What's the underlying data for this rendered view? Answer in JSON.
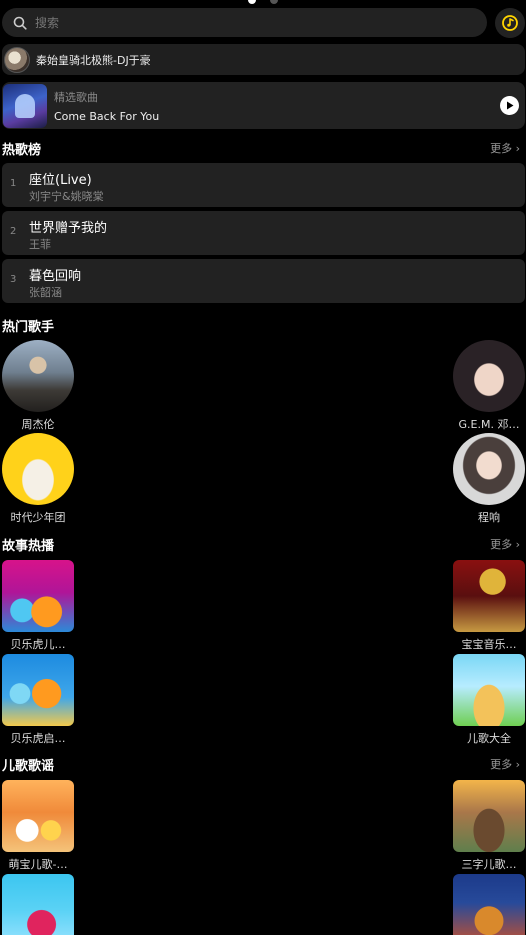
{
  "search": {
    "placeholder": "搜索"
  },
  "now_playing": {
    "title": "秦始皇骑北极熊-DJ于豪"
  },
  "featured": {
    "label": "精选歌曲",
    "song": "Come Back For You"
  },
  "hot_songs": {
    "title": "热歌榜",
    "more": "更多",
    "items": [
      {
        "rank": "1",
        "song": "座位(Live)",
        "artist": "刘宇宁&姚晓棠"
      },
      {
        "rank": "2",
        "song": "世界赠予我的",
        "artist": "王菲"
      },
      {
        "rank": "3",
        "song": "暮色回响",
        "artist": "张韶涵"
      }
    ]
  },
  "hot_singers": {
    "title": "热门歌手",
    "items": [
      {
        "name": "周杰伦"
      },
      {
        "name": "G.E.M. 邓…"
      },
      {
        "name": "时代少年团"
      },
      {
        "name": "程响"
      }
    ]
  },
  "stories": {
    "title": "故事热播",
    "more": "更多",
    "items": [
      {
        "name": "贝乐虎儿…"
      },
      {
        "name": "宝宝音乐…"
      },
      {
        "name": "贝乐虎启…"
      },
      {
        "name": "儿歌大全"
      }
    ]
  },
  "kids_songs": {
    "title": "儿歌歌谣",
    "more": "更多",
    "items": [
      {
        "name": "萌宝儿歌-…"
      },
      {
        "name": "三字儿歌…"
      },
      {
        "name": ""
      },
      {
        "name": ""
      }
    ]
  },
  "colors": {
    "background": "#000000",
    "card": "#222222",
    "muted": "#888888",
    "accent": "#ffd400"
  }
}
